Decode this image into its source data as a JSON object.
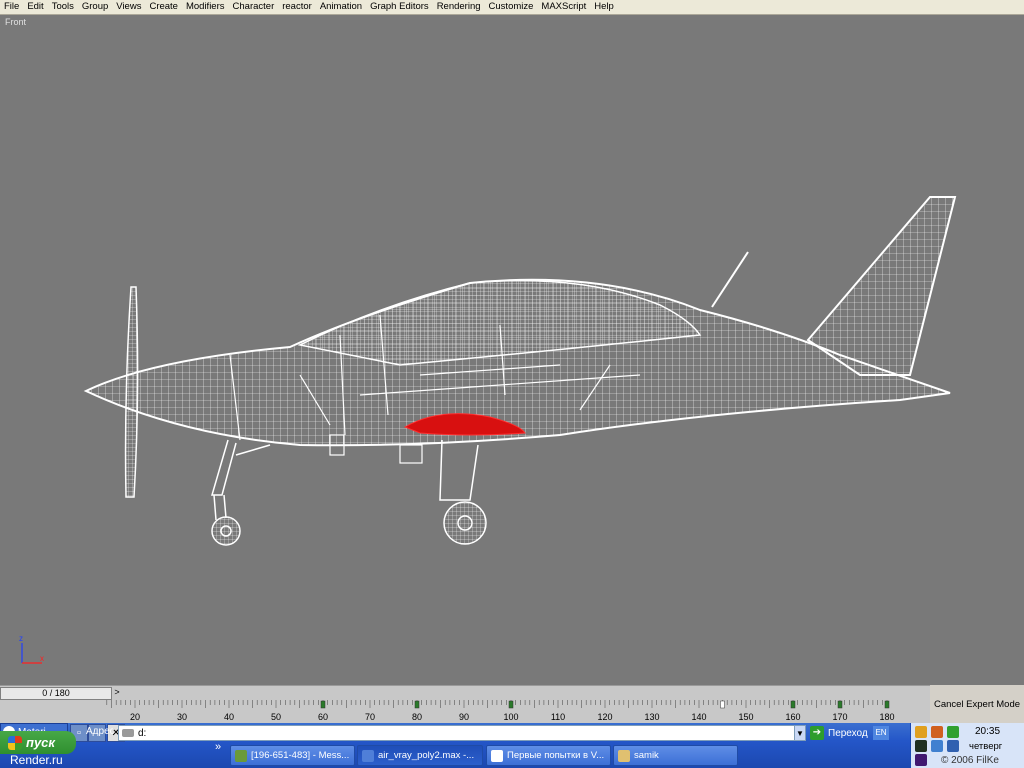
{
  "menu": [
    "File",
    "Edit",
    "Tools",
    "Group",
    "Views",
    "Create",
    "Modifiers",
    "Character",
    "reactor",
    "Animation",
    "Graph Editors",
    "Rendering",
    "Customize",
    "MAXScript",
    "Help"
  ],
  "viewport": {
    "label": "Front",
    "background": "#797979",
    "wire_color": "#ffffff",
    "selected_color": "#d81010"
  },
  "timeline": {
    "slider_text": "0 / 180",
    "next_arrow": ">",
    "ticks": [
      "20",
      "30",
      "40",
      "50",
      "60",
      "70",
      "80",
      "90",
      "100",
      "110",
      "120",
      "130",
      "140",
      "150",
      "160",
      "170",
      "180"
    ],
    "keyframes": [
      60,
      80,
      100,
      145,
      160,
      170,
      180
    ]
  },
  "status": {
    "cancel_expert": "Cancel Expert Mode"
  },
  "taskbar": {
    "start_label": "пуск",
    "material_btn": "Materi...",
    "address_label": "Адрес",
    "address_value": "d:",
    "go_label": "Переход",
    "lang": "EN",
    "chevron": "»",
    "watermark": "Render.ru",
    "tasks": [
      {
        "label": "[196-651-483] - Mess...",
        "active": false
      },
      {
        "label": "air_vray_poly2.max -...",
        "active": true
      },
      {
        "label": "Первые попытки в V...",
        "active": false
      },
      {
        "label": "samik",
        "active": false
      }
    ]
  },
  "tray": {
    "time": "20:35",
    "day": "четверг",
    "copyright": "© 2006 FilKe"
  }
}
